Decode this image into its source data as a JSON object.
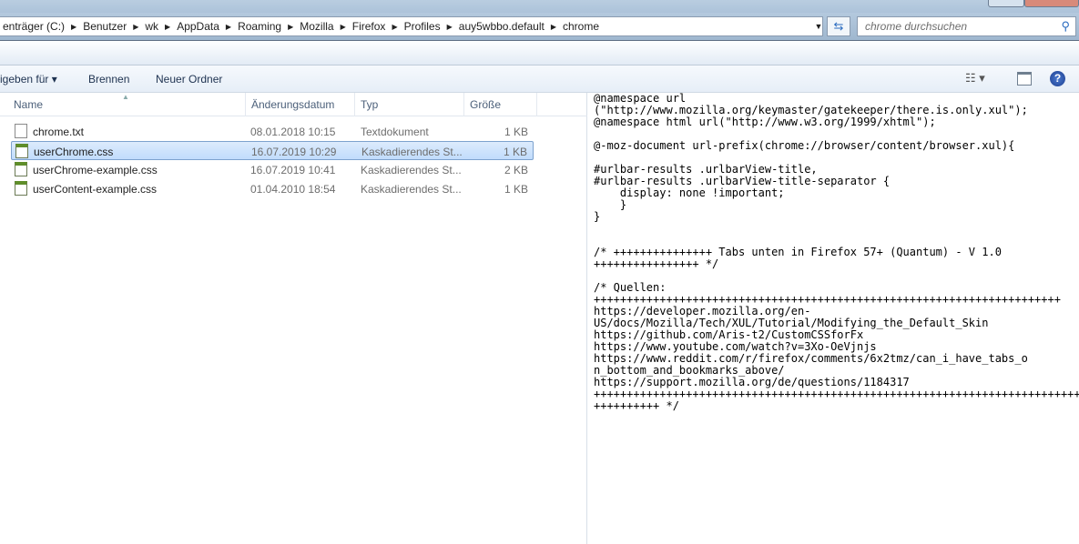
{
  "breadcrumb": [
    "enträger (C:)",
    "Benutzer",
    "wk",
    "AppData",
    "Roaming",
    "Mozilla",
    "Firefox",
    "Profiles",
    "auy5wbbo.default",
    "chrome"
  ],
  "search": {
    "placeholder": "chrome durchsuchen"
  },
  "toolbar": {
    "share_label": "igeben für ▾",
    "burn_label": "Brennen",
    "new_folder_label": "Neuer Ordner"
  },
  "columns": {
    "name": "Name",
    "date": "Änderungsdatum",
    "type": "Typ",
    "size": "Größe"
  },
  "files": [
    {
      "name": "chrome.txt",
      "date": "08.01.2018 10:15",
      "type": "Textdokument",
      "size": "1 KB",
      "icon": "text-file-icon"
    },
    {
      "name": "userChrome.css",
      "date": "16.07.2019 10:29",
      "type": "Kaskadierendes St...",
      "size": "1 KB",
      "icon": "css-file-icon",
      "selected": true
    },
    {
      "name": "userChrome-example.css",
      "date": "16.07.2019 10:41",
      "type": "Kaskadierendes St...",
      "size": "2 KB",
      "icon": "css-file-icon"
    },
    {
      "name": "userContent-example.css",
      "date": "01.04.2010 18:54",
      "type": "Kaskadierendes St...",
      "size": "1 KB",
      "icon": "css-file-icon"
    }
  ],
  "preview_lines": [
    "@namespace url",
    "(\"http://www.mozilla.org/keymaster/gatekeeper/there.is.only.xul\");",
    "@namespace html url(\"http://www.w3.org/1999/xhtml\");",
    "",
    "@-moz-document url-prefix(chrome://browser/content/browser.xul){",
    "",
    "#urlbar-results .urlbarView-title,",
    "#urlbar-results .urlbarView-title-separator {",
    "    display: none !important;",
    "    }",
    "}",
    "",
    "",
    "/* +++++++++++++++ Tabs unten in Firefox 57+ (Quantum) - V 1.0",
    "++++++++++++++++ */",
    "",
    "/* Quellen:",
    "+++++++++++++++++++++++++++++++++++++++++++++++++++++++++++++++++++++++",
    "https://developer.mozilla.org/en-",
    "US/docs/Mozilla/Tech/XUL/Tutorial/Modifying_the_Default_Skin",
    "https://github.com/Aris-t2/CustomCSSforFx",
    "https://www.youtube.com/watch?v=3Xo-OeVjnjs",
    "https://www.reddit.com/r/firefox/comments/6x2tmz/can_i_have_tabs_o",
    "n_bottom_and_bookmarks_above/",
    "https://support.mozilla.org/de/questions/1184317",
    "++++++++++++++++++++++++++++++++++++++++++++++++++++++++++++++++++++++++++",
    "++++++++++ */"
  ]
}
